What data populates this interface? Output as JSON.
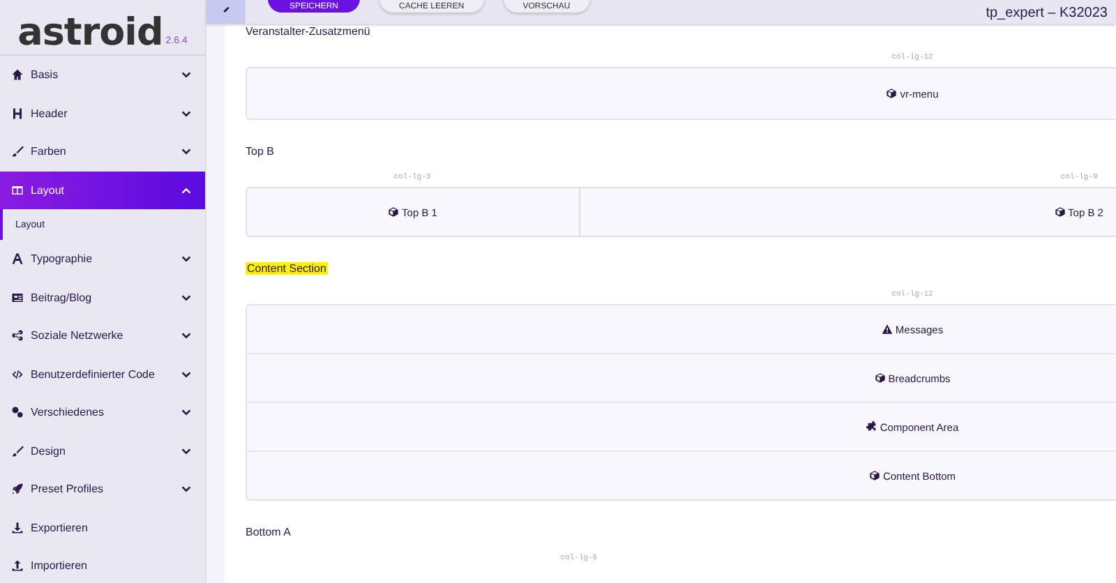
{
  "logo": {
    "name": "astroid",
    "version": "2.6.4"
  },
  "toolbar": {
    "buttons": [
      {
        "label": "SPEICHERN",
        "kind": "primary"
      },
      {
        "label": "CACHE LEEREN",
        "kind": "secondary"
      },
      {
        "label": "VORSCHAU",
        "kind": "secondary"
      }
    ],
    "site": "tp_expert – K32023"
  },
  "sidebar": {
    "items": [
      {
        "label": "Basis",
        "kind": "group",
        "expanded": false,
        "selected": false
      },
      {
        "label": "Header",
        "kind": "group",
        "expanded": false,
        "selected": false
      },
      {
        "label": "Farben",
        "kind": "group",
        "expanded": false,
        "selected": false
      },
      {
        "label": "Layout",
        "kind": "group",
        "expanded": true,
        "selected": true,
        "children": [
          {
            "label": "Layout",
            "selected": true
          }
        ]
      },
      {
        "label": "Typographie",
        "kind": "group",
        "expanded": false,
        "selected": false
      },
      {
        "label": "Beitrag/Blog",
        "kind": "group",
        "expanded": false,
        "selected": false
      },
      {
        "label": "Soziale Netzwerke",
        "kind": "group",
        "expanded": false,
        "selected": false
      },
      {
        "label": "Benutzerdefinierter Code",
        "kind": "group",
        "expanded": false,
        "selected": false
      },
      {
        "label": "Verschiedenes",
        "kind": "group",
        "expanded": false,
        "selected": false
      },
      {
        "label": "Design",
        "kind": "group",
        "expanded": false,
        "selected": false
      },
      {
        "label": "Preset Profiles",
        "kind": "group",
        "expanded": false,
        "selected": false
      },
      {
        "label": "Exportieren",
        "kind": "link",
        "selected": false
      },
      {
        "label": "Importieren",
        "kind": "link",
        "selected": false
      }
    ]
  },
  "sections": [
    {
      "title": "Veranstalter-Zusatzmenü",
      "highlighted": false,
      "columns": [
        {
          "class": "col-lg-12",
          "modules": [
            {
              "label": "vr-menu",
              "kind": "module"
            }
          ]
        }
      ]
    },
    {
      "title": "Top B",
      "highlighted": false,
      "columns": [
        {
          "class": "col-lg-3",
          "modules": [
            {
              "label": "Top B 1",
              "kind": "module"
            }
          ]
        },
        {
          "class": "col-lg-9",
          "modules": [
            {
              "label": "Top B 2",
              "kind": "module"
            }
          ]
        }
      ]
    },
    {
      "title": "Content Section",
      "highlighted": true,
      "columns": [
        {
          "class": "col-lg-12",
          "modules": [
            {
              "label": "Messages",
              "kind": "message"
            },
            {
              "label": "Breadcrumbs",
              "kind": "module"
            },
            {
              "label": "Component Area",
              "kind": "component"
            },
            {
              "label": "Content Bottom",
              "kind": "module"
            }
          ]
        }
      ]
    },
    {
      "title": "Bottom A",
      "highlighted": false,
      "columns": [
        {
          "class": "col-lg-6"
        }
      ]
    }
  ]
}
